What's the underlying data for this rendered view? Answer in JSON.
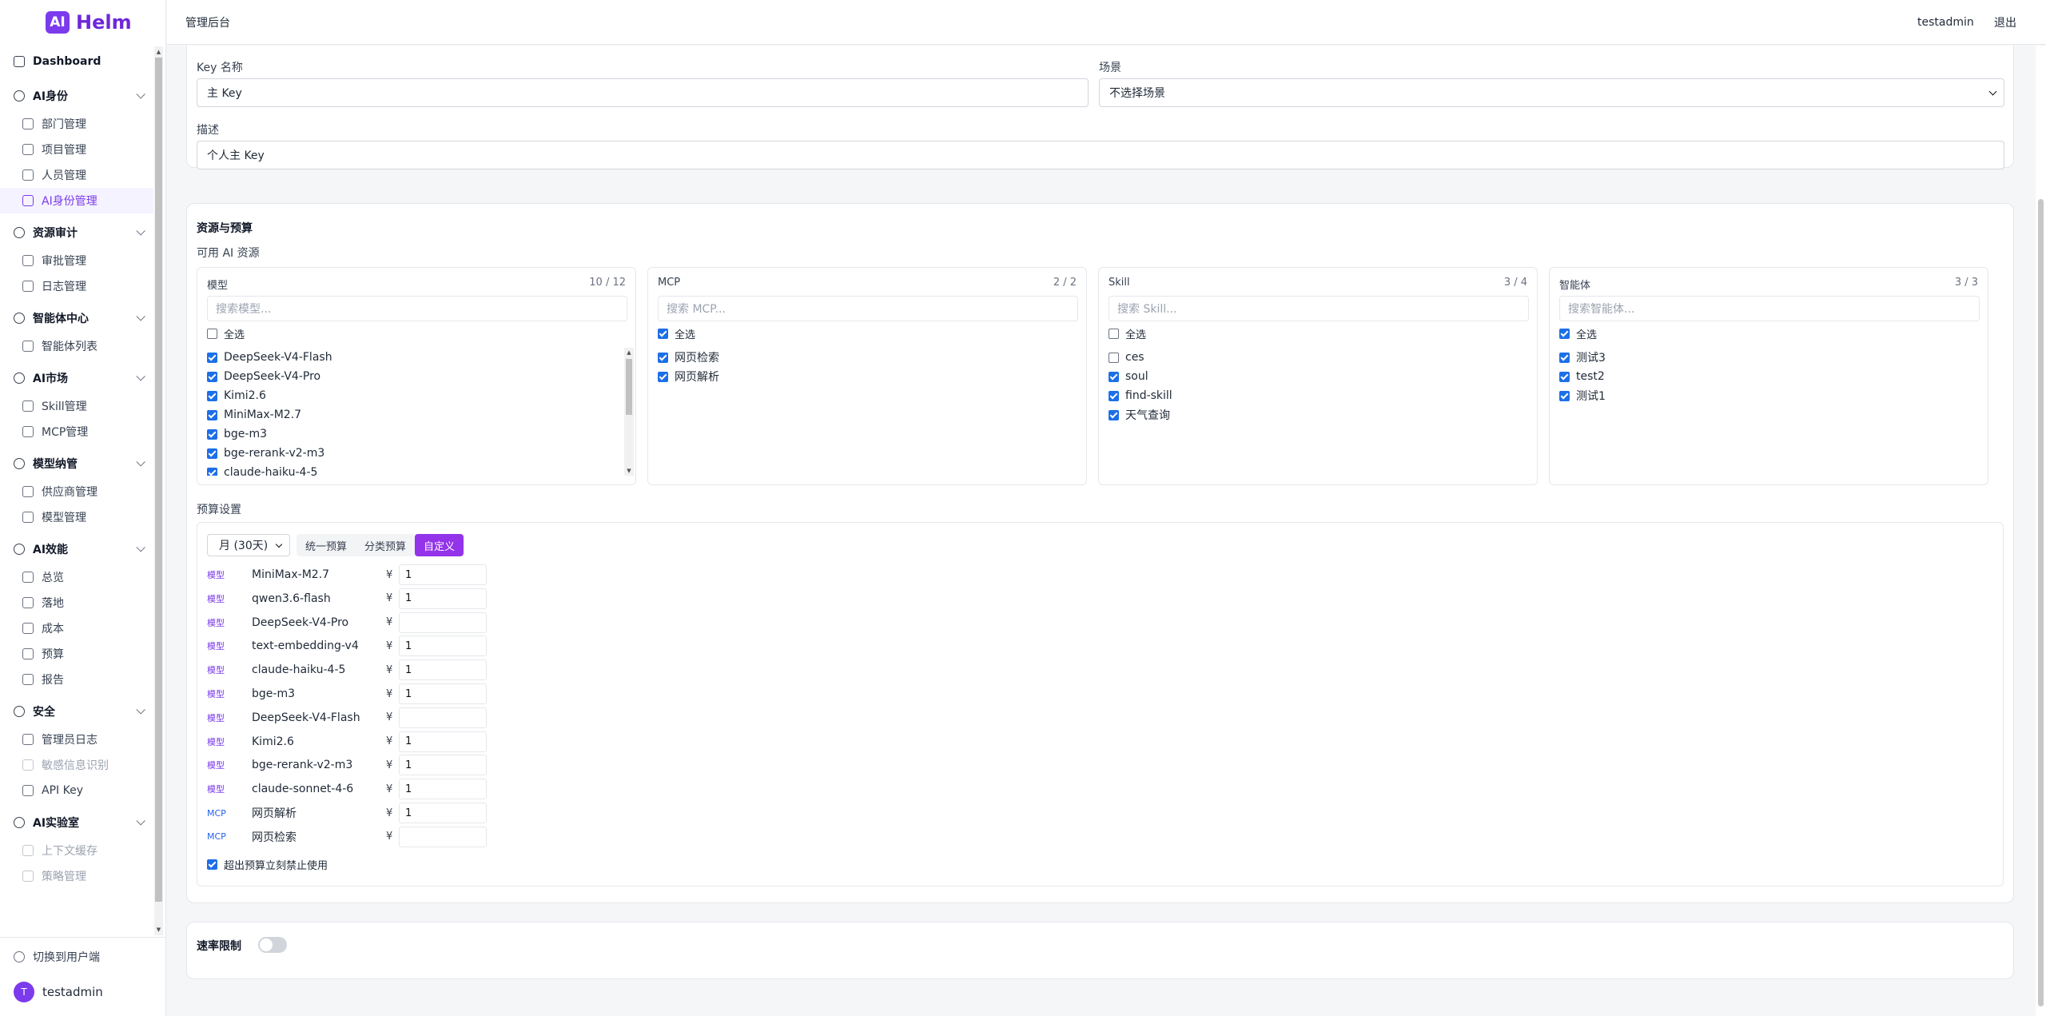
{
  "app": {
    "logo_mark": "AI",
    "logo_text": "Helm"
  },
  "header": {
    "title": "管理后台",
    "username": "testadmin",
    "logout": "退出"
  },
  "sidebar": {
    "dashboard": "Dashboard",
    "groups": [
      {
        "label": "AI身份",
        "items": [
          "部门管理",
          "项目管理",
          "人员管理",
          "AI身份管理"
        ]
      },
      {
        "label": "资源审计",
        "items": [
          "审批管理",
          "日志管理"
        ]
      },
      {
        "label": "智能体中心",
        "items": [
          "智能体列表"
        ]
      },
      {
        "label": "AI市场",
        "items": [
          "Skill管理",
          "MCP管理"
        ]
      },
      {
        "label": "模型纳管",
        "items": [
          "供应商管理",
          "模型管理"
        ]
      },
      {
        "label": "AI效能",
        "items": [
          "总览",
          "落地",
          "成本",
          "预算",
          "报告"
        ]
      },
      {
        "label": "安全",
        "items": [
          "管理员日志",
          "敏感信息识别",
          "API Key"
        ]
      },
      {
        "label": "AI实验室",
        "items": [
          "上下文缓存",
          "策略管理"
        ]
      }
    ],
    "switch_user": "切换到用户端",
    "user": {
      "initial": "T",
      "name": "testadmin"
    }
  },
  "form": {
    "key_name_label": "Key 名称",
    "key_name_value": "主 Key",
    "scene_label": "场景",
    "scene_value": "不选择场景",
    "desc_label": "描述",
    "desc_value": "个人主 Key"
  },
  "resources": {
    "section_title": "资源与预算",
    "available_label": "可用 AI 资源",
    "select_all": "全选",
    "panels": [
      {
        "title": "模型",
        "count": "10 / 12",
        "search": "搜索模型...",
        "all_checked": false,
        "items": [
          {
            "label": "DeepSeek-V4-Flash",
            "checked": true
          },
          {
            "label": "DeepSeek-V4-Pro",
            "checked": true
          },
          {
            "label": "Kimi2.6",
            "checked": true
          },
          {
            "label": "MiniMax-M2.7",
            "checked": true
          },
          {
            "label": "bge-m3",
            "checked": true
          },
          {
            "label": "bge-rerank-v2-m3",
            "checked": true
          },
          {
            "label": "claude-haiku-4-5",
            "checked": true
          }
        ]
      },
      {
        "title": "MCP",
        "count": "2 / 2",
        "search": "搜索 MCP...",
        "all_checked": true,
        "items": [
          {
            "label": "网页检索",
            "checked": true
          },
          {
            "label": "网页解析",
            "checked": true
          }
        ]
      },
      {
        "title": "Skill",
        "count": "3 / 4",
        "search": "搜索 Skill...",
        "all_checked": false,
        "items": [
          {
            "label": "ces",
            "checked": false
          },
          {
            "label": "soul",
            "checked": true
          },
          {
            "label": "find-skill",
            "checked": true
          },
          {
            "label": "天气查询",
            "checked": true
          }
        ]
      },
      {
        "title": "智能体",
        "count": "3 / 3",
        "search": "搜索智能体...",
        "all_checked": true,
        "items": [
          {
            "label": "测试3",
            "checked": true
          },
          {
            "label": "test2",
            "checked": true
          },
          {
            "label": "测试1",
            "checked": true
          }
        ]
      }
    ]
  },
  "budget": {
    "label": "预算设置",
    "period": "月 (30天)",
    "modes": [
      "统一预算",
      "分类预算",
      "自定义"
    ],
    "active_mode": 2,
    "currency": "¥",
    "rows": [
      {
        "tag": "模型",
        "name": "MiniMax-M2.7",
        "amount": "1"
      },
      {
        "tag": "模型",
        "name": "qwen3.6-flash",
        "amount": "1"
      },
      {
        "tag": "模型",
        "name": "DeepSeek-V4-Pro",
        "amount": ""
      },
      {
        "tag": "模型",
        "name": "text-embedding-v4",
        "amount": "1"
      },
      {
        "tag": "模型",
        "name": "claude-haiku-4-5",
        "amount": "1"
      },
      {
        "tag": "模型",
        "name": "bge-m3",
        "amount": "1"
      },
      {
        "tag": "模型",
        "name": "DeepSeek-V4-Flash",
        "amount": ""
      },
      {
        "tag": "模型",
        "name": "Kimi2.6",
        "amount": "1"
      },
      {
        "tag": "模型",
        "name": "bge-rerank-v2-m3",
        "amount": "1"
      },
      {
        "tag": "模型",
        "name": "claude-sonnet-4-6",
        "amount": "1"
      },
      {
        "tag": "MCP",
        "name": "网页解析",
        "amount": "1"
      },
      {
        "tag": "MCP",
        "name": "网页检索",
        "amount": ""
      }
    ],
    "block_over": "超出预算立刻禁止使用",
    "block_over_checked": true
  },
  "rate_limit": {
    "label": "速率限制",
    "enabled": false
  }
}
